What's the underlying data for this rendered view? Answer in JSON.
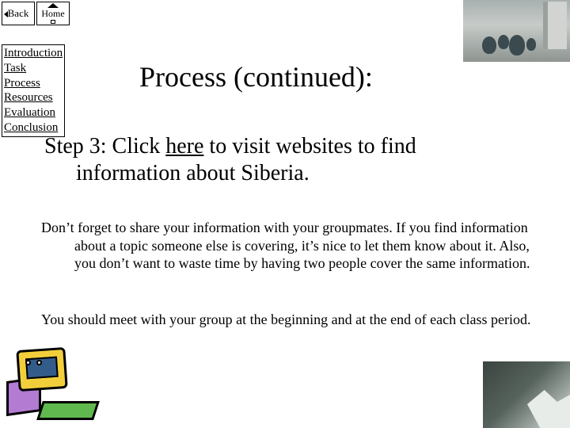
{
  "nav": {
    "back": "Back",
    "home": "Home"
  },
  "sidebar": {
    "items": [
      {
        "label": "Introduction"
      },
      {
        "label": "Task"
      },
      {
        "label": "Process"
      },
      {
        "label": "Resources"
      },
      {
        "label": "Evaluation"
      },
      {
        "label": "Conclusion"
      }
    ]
  },
  "title": "Process (continued):",
  "step3": {
    "pre": "Step 3: Click ",
    "link": "here",
    "post": " to visit websites to find",
    "line2": "information about Siberia."
  },
  "para1": "Don’t forget to share your information with your groupmates.  If you find information about a topic someone else is covering, it’s nice to let them know about it.  Also, you don’t want to waste time by having two people cover the same information.",
  "para2": "You should meet with your group at the beginning and at the end of each class period."
}
